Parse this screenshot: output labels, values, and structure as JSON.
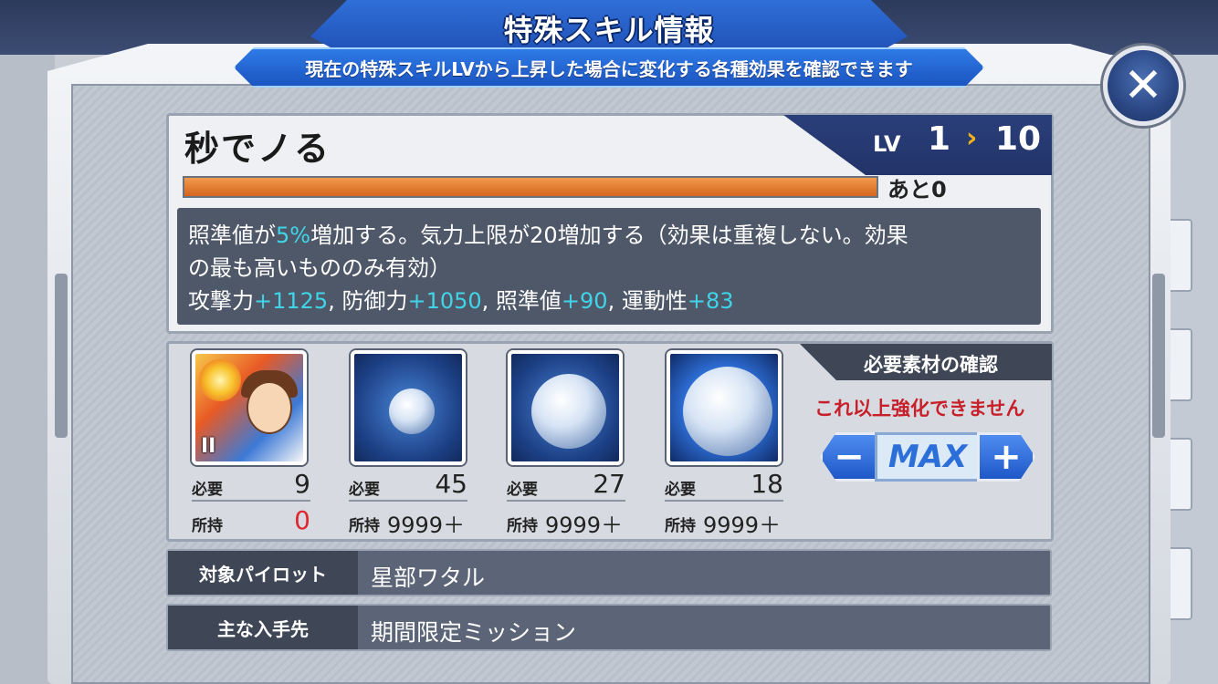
{
  "dialog": {
    "title": "特殊スキル情報",
    "subtitle": "現在の特殊スキルLVから上昇した場合に変化する各種効果を確認できます",
    "close_symbol": "✕"
  },
  "skill": {
    "name": "秒でノる",
    "lv_label": "LV",
    "current_level": "1",
    "arrow": "›",
    "max_level": "10",
    "exp_progress": 1.0,
    "exp_remaining_label": "あと0",
    "description": {
      "line1_a": "照準値が",
      "line1_b": "5%",
      "line1_c": "増加する。気力上限が20増加する（効果は重複しない。効果",
      "line2": "の最も高いもののみ有効）",
      "stat1_label": "攻撃力",
      "stat1_value": "+1125",
      "sep1": ", 防御力",
      "stat2_value": "+1050",
      "sep2": ", 照準値",
      "stat3_value": "+90",
      "sep3": ", 運動性",
      "stat4_value": "+83"
    }
  },
  "materials": {
    "header": "必要素材の確認",
    "warning": "これ以上強化できません",
    "stepper": {
      "minus": "−",
      "value": "MAX",
      "plus": "+"
    },
    "items": [
      {
        "icon": "pilot-wataru-icon",
        "badge": "II",
        "required_label": "必要",
        "required": "9",
        "owned_label": "所持",
        "owned": "0"
      },
      {
        "icon": "small-orb-icon",
        "required_label": "必要",
        "required": "45",
        "owned_label": "所持",
        "owned": "9999＋"
      },
      {
        "icon": "medium-orb-icon",
        "required_label": "必要",
        "required": "27",
        "owned_label": "所持",
        "owned": "9999＋"
      },
      {
        "icon": "large-orb-icon",
        "required_label": "必要",
        "required": "18",
        "owned_label": "所持",
        "owned": "9999＋"
      }
    ]
  },
  "info": {
    "pilot_label": "対象パイロット",
    "pilot_value": "星部ワタル",
    "source_label": "主な入手先",
    "source_value": "期間限定ミッション"
  },
  "colors": {
    "accent_blue": "#1f58c8",
    "exp_bar": "#d3651e",
    "highlight_cyan": "#40d4e8",
    "warning_red": "#c8202a",
    "lv_arrow": "#f5b21c"
  }
}
